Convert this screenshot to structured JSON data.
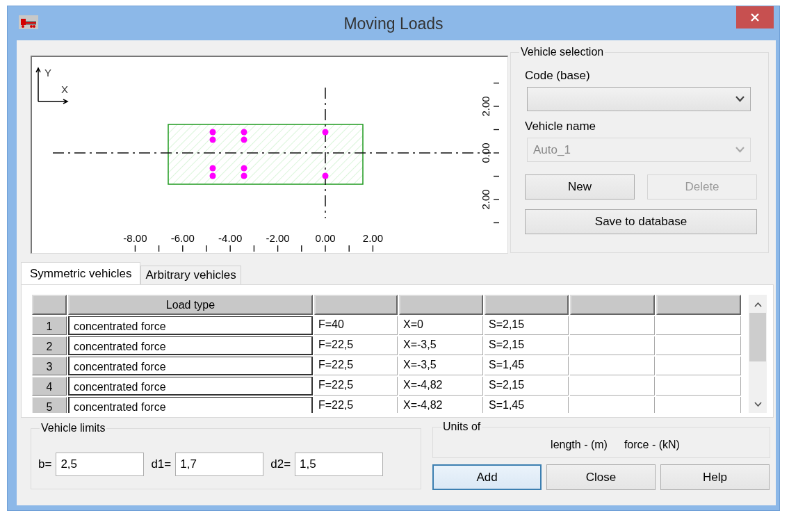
{
  "window": {
    "title": "Moving Loads"
  },
  "plot": {
    "axis_labels": [
      "Y",
      "X"
    ],
    "x_tick_labels": [
      "-8.00",
      "-6.00",
      "-4.00",
      "-2.00",
      "0.00",
      "2.00"
    ],
    "y_tick_labels": [
      "2.00",
      "0.00",
      "2.00"
    ]
  },
  "vehicle_selection": {
    "title": "Vehicle selection",
    "code_label": "Code (base)",
    "code_combo": {
      "disabled": false
    },
    "name_label": "Vehicle name",
    "name_combo": {
      "value": "Auto_1",
      "disabled": true
    },
    "buttons": [
      {
        "label": "New",
        "disabled": false
      },
      {
        "label": "Delete",
        "disabled": true
      },
      {
        "label": "Save to database",
        "disabled": false
      }
    ]
  },
  "tabs": [
    {
      "label": "Symmetric vehicles",
      "selected": true
    },
    {
      "label": "Arbitrary vehicles",
      "selected": false
    }
  ],
  "table": {
    "columns": [
      "Load type"
    ],
    "rows": [
      {
        "number": "1",
        "cells": [
          "concentrated force",
          "F=40",
          "X=0",
          "S=2,15"
        ]
      },
      {
        "number": "2",
        "cells": [
          "concentrated force",
          "F=22,5",
          "X=-3,5",
          "S=2,15"
        ]
      },
      {
        "number": "3",
        "cells": [
          "concentrated force",
          "F=22,5",
          "X=-3,5",
          "S=1,45"
        ]
      },
      {
        "number": "4",
        "cells": [
          "concentrated force",
          "F=22,5",
          "X=-4,82",
          "S=2,15"
        ]
      },
      {
        "number": "5",
        "cells": [
          "concentrated force",
          "F=22,5",
          "X=-4,82",
          "S=1,45"
        ]
      }
    ]
  },
  "vehicle_limits": {
    "title": "Vehicle limits",
    "fields": [
      {
        "label": "b=",
        "value": "2,5"
      },
      {
        "label": "d1=",
        "value": "1,7"
      },
      {
        "label": "d2=",
        "value": "1,5"
      }
    ]
  },
  "units": {
    "title": "Units of",
    "items": [
      "length - (m)",
      "force - (kN)"
    ]
  },
  "buttons": [
    {
      "label": "Add",
      "default": true
    },
    {
      "label": "Close",
      "default": false
    },
    {
      "label": "Help",
      "default": false
    }
  ]
}
